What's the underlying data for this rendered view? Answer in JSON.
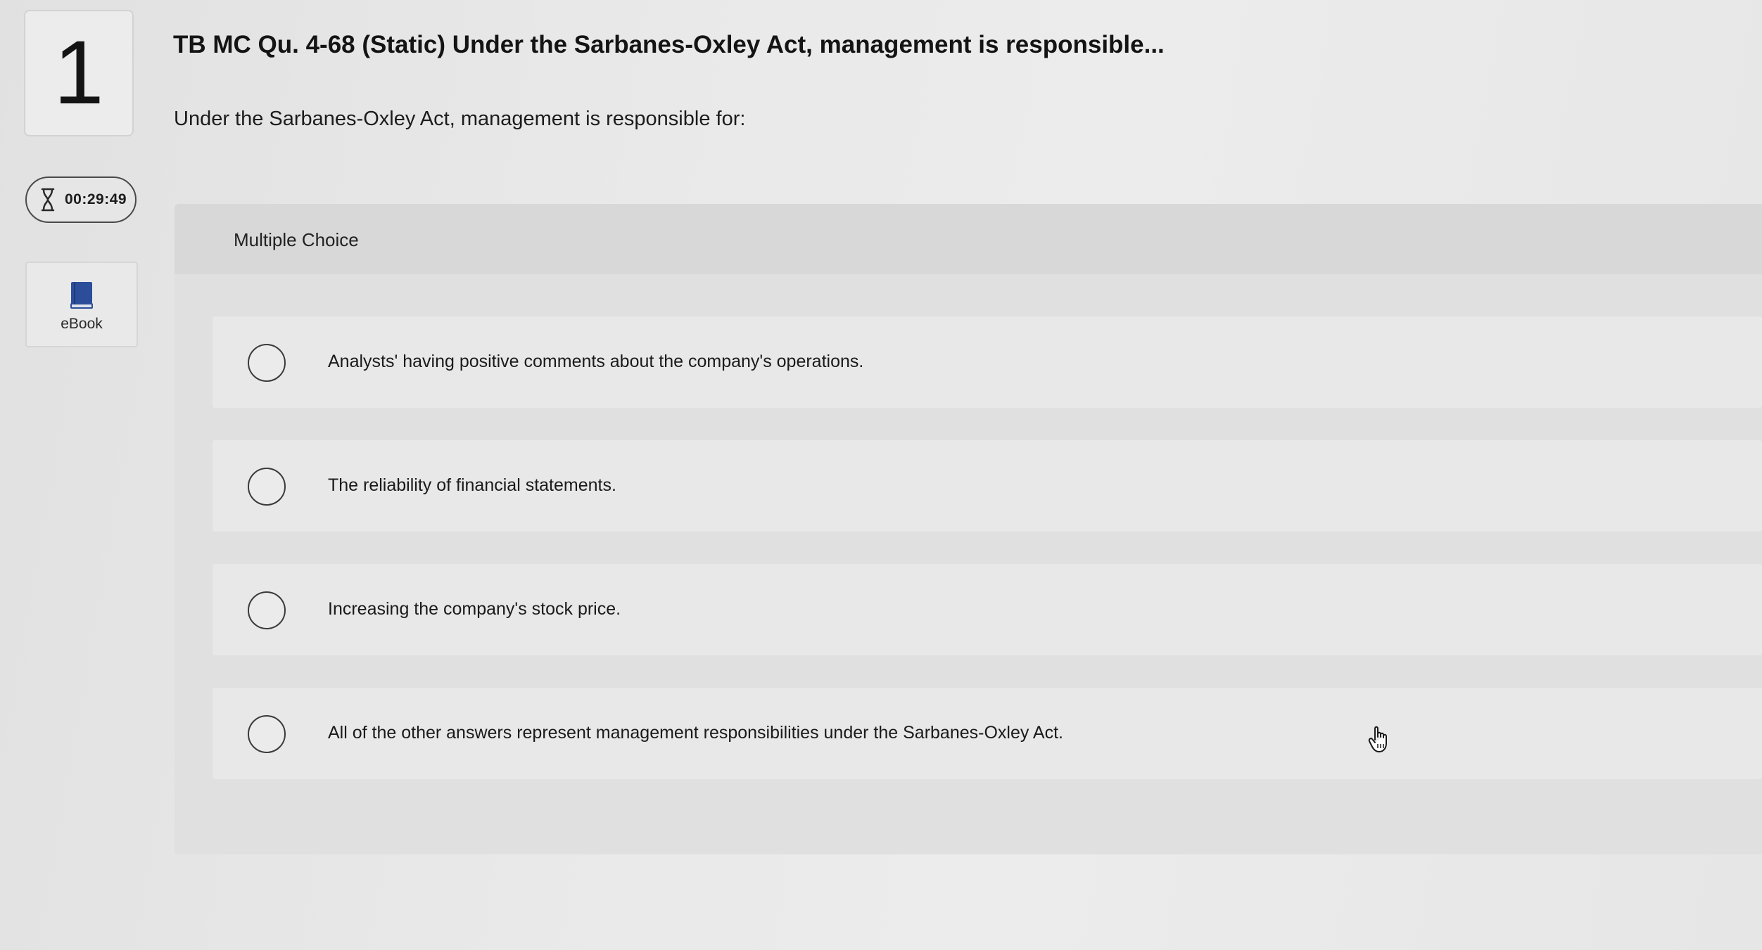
{
  "question": {
    "number": "1",
    "title": "TB MC Qu. 4-68 (Static) Under the Sarbanes-Oxley Act, management is responsible...",
    "prompt": "Under the Sarbanes-Oxley Act, management is responsible for:"
  },
  "sidebar": {
    "timer": {
      "icon": "hourglass-icon",
      "value": "00:29:49"
    },
    "ebook": {
      "icon": "book-icon",
      "label": "eBook",
      "icon_color": "#2c4e9a"
    }
  },
  "choices_panel": {
    "title": "Multiple Choice",
    "options": [
      {
        "label": "Analysts' having positive comments about the company's operations.",
        "selected": false
      },
      {
        "label": "The reliability of financial statements.",
        "selected": false
      },
      {
        "label": "Increasing the company's stock price.",
        "selected": false
      },
      {
        "label": "All of the other answers represent management responsibilities under the Sarbanes-Oxley Act.",
        "selected": false
      }
    ]
  },
  "cursor": {
    "icon": "hand-pointer-icon"
  }
}
